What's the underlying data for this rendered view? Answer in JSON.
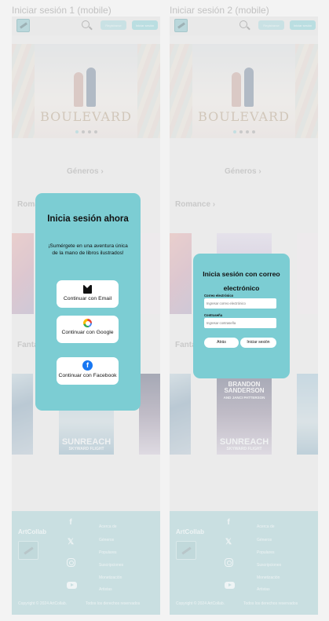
{
  "frames": [
    {
      "title": "Iniciar sesión 1 (mobile)",
      "topbar": {
        "register_label": "Registrarse",
        "login_label": "Iniciar sesión"
      },
      "hero_title": "BOULEVARD",
      "sections": {
        "genres": "Géneros ›",
        "romance": "Romance ›",
        "fantasy": "Fantasía ›"
      },
      "book_title": "SUNREACH",
      "book_subtitle": "SKYWARD FLIGHT",
      "footer": {
        "brand": "ArtCollab",
        "links": [
          "Acerca de",
          "Géneros",
          "Populares",
          "Suscripciones",
          "Monetización",
          "Artistas"
        ],
        "copyright": "Copyright © 2024 ArtCollab.",
        "rights": "Todos los derechos reservados"
      },
      "modal": {
        "title": "Inicia sesión ahora",
        "text": "¡Sumérgete en una aventura única de la mano de libros ilustrados!",
        "email_label": "Continuar con Email",
        "google_label": "Continuar con Google",
        "facebook_label": "Continuar con Facebook"
      }
    },
    {
      "title": "Iniciar sesión 2 (mobile)",
      "topbar": {
        "register_label": "Registrarse",
        "login_label": "Iniciar sesión"
      },
      "hero_title": "BOULEVARD",
      "sections": {
        "genres": "Géneros ›",
        "romance": "Romance ›",
        "fantasy": "Fantasía ›"
      },
      "book_title": "BRANDON SANDERSON",
      "book_author2": "AND JANCI PATTERSON",
      "book_bottom": "SUNREACH",
      "book_subtitle": "SKYWARD FLIGHT",
      "footer": {
        "brand": "ArtCollab",
        "links": [
          "Acerca de",
          "Géneros",
          "Populares",
          "Suscripciones",
          "Monetización",
          "Artistas"
        ],
        "copyright": "Copyright © 2024 ArtCollab.",
        "rights": "Todos los derechos reservados"
      },
      "modal": {
        "title": "Inicia sesión con correo electrónico",
        "email_field_label": "Correo electrónico",
        "email_placeholder": "Ingresar correo electrónico",
        "password_field_label": "Contraseña",
        "password_placeholder": "Ingresar contraseña",
        "back_label": "Atrás",
        "submit_label": "Iniciar sesión"
      }
    }
  ],
  "colors": {
    "accent": "#7ccdd3",
    "footer": "#a9d1d5",
    "frame_bg": "#e8e8e8"
  }
}
